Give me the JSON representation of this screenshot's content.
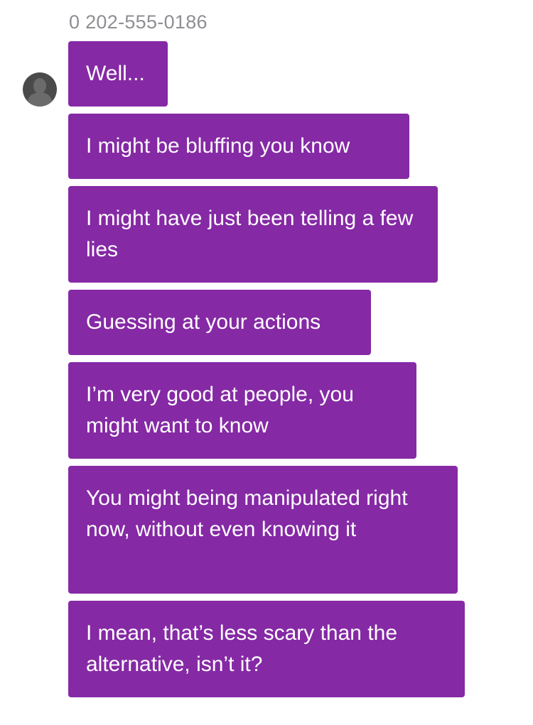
{
  "conversation": {
    "sender_number": "0 202-555-0186",
    "bubble_color": "#8529a5",
    "avatar_icon": "person-silhouette-icon",
    "messages": [
      "Well...",
      "I might be bluffing you know",
      "I might have just been telling a few lies",
      "Guessing at your actions",
      "I’m very good at people, you might want to know",
      "You might being manipulated right now, without even knowing it",
      "I mean, that’s less scary than the alternative, isn’t it?"
    ]
  }
}
